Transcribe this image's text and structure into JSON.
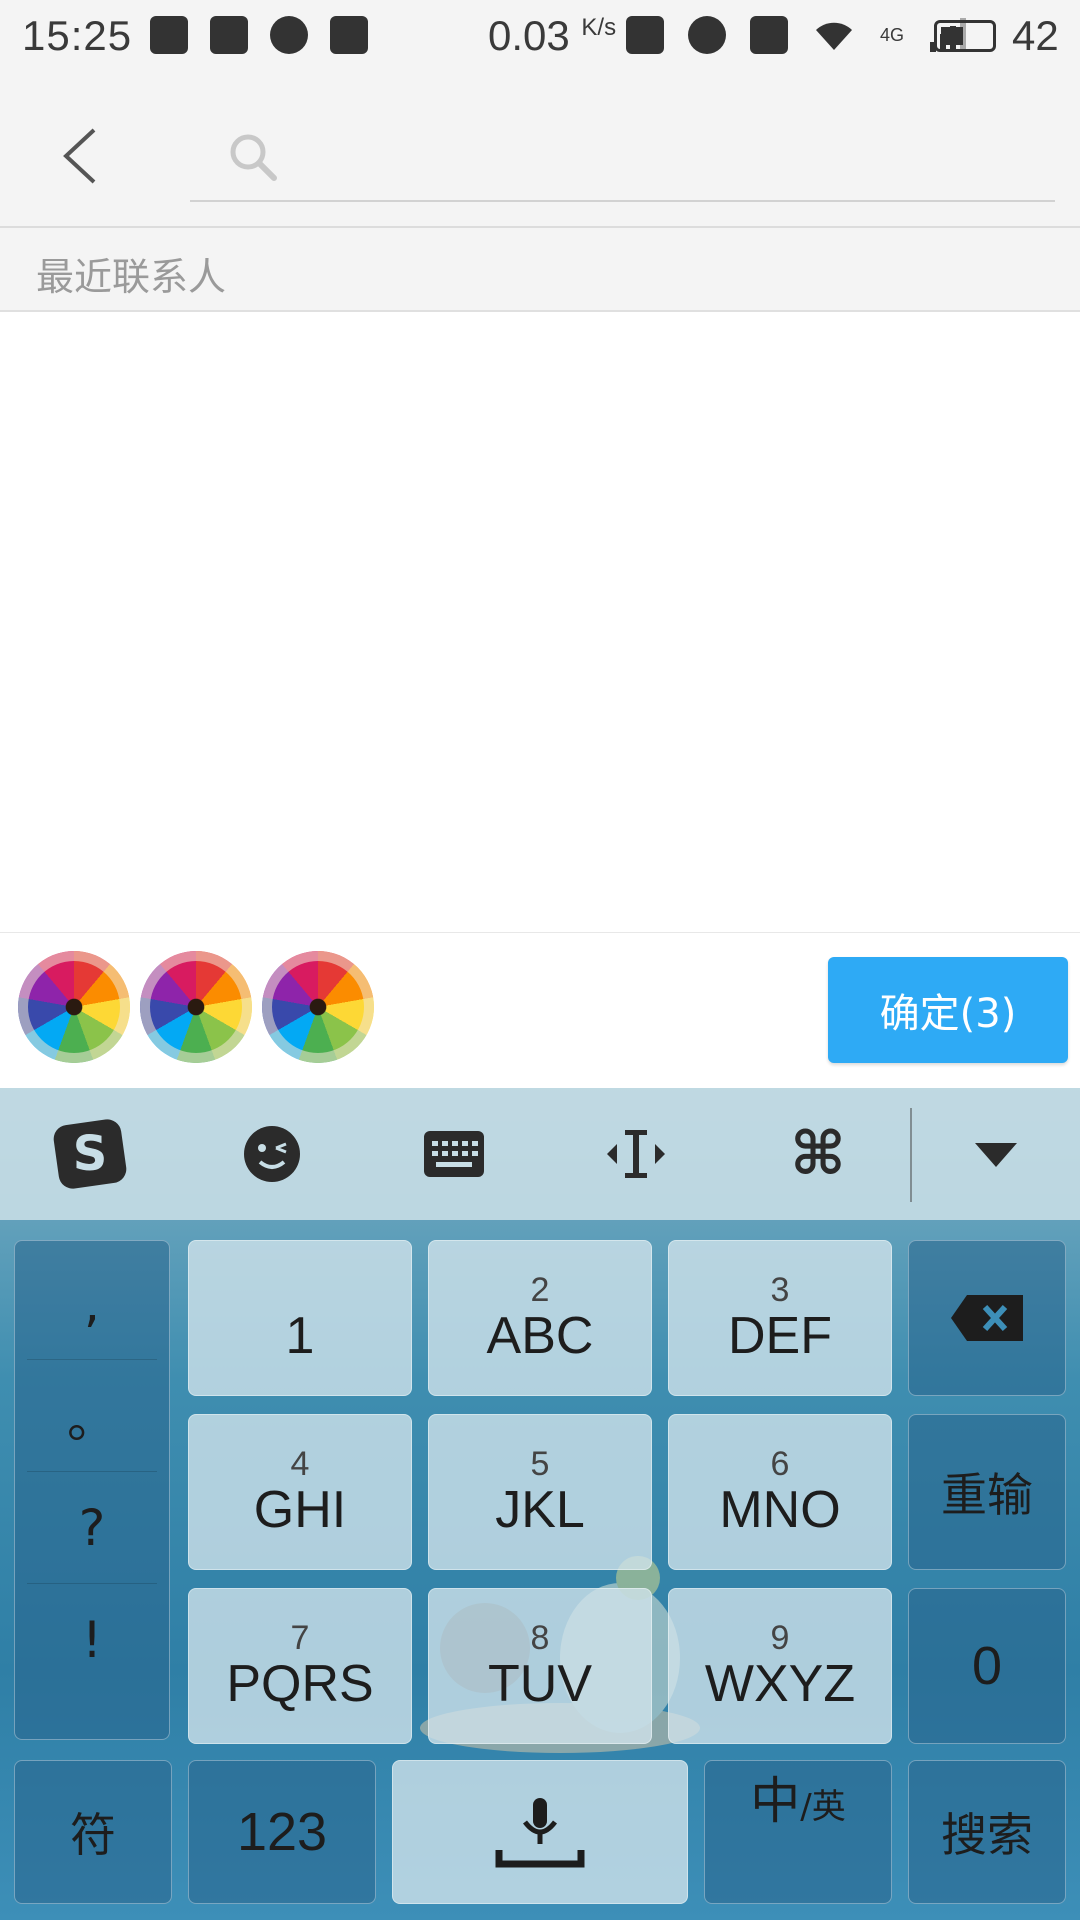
{
  "status_bar": {
    "time": "15:25",
    "speed": "0.03",
    "speed_unit": "K/s",
    "network": "4G",
    "battery": "42"
  },
  "search": {
    "placeholder": ""
  },
  "section": {
    "title": "最近联系人"
  },
  "selection": {
    "avatar_count": 3,
    "confirm_label": "确定(3)"
  },
  "keyboard": {
    "punctuation": [
      ",",
      "。",
      "?",
      "!"
    ],
    "keys": {
      "k1": {
        "num": "",
        "letters": "1"
      },
      "k2": {
        "num": "2",
        "letters": "ABC"
      },
      "k3": {
        "num": "3",
        "letters": "DEF"
      },
      "k4": {
        "num": "4",
        "letters": "GHI"
      },
      "k5": {
        "num": "5",
        "letters": "JKL"
      },
      "k6": {
        "num": "6",
        "letters": "MNO"
      },
      "k7": {
        "num": "7",
        "letters": "PQRS"
      },
      "k8": {
        "num": "8",
        "letters": "TUV"
      },
      "k9": {
        "num": "9",
        "letters": "WXYZ"
      }
    },
    "reset_label": "重输",
    "zero_label": "0",
    "symbol_label": "符",
    "num_label": "123",
    "lang_main": "中",
    "lang_alt": "/英",
    "search_label": "搜索"
  },
  "colors": {
    "confirm": "#2eaaf5",
    "header_bg": "#f4f4f4"
  }
}
